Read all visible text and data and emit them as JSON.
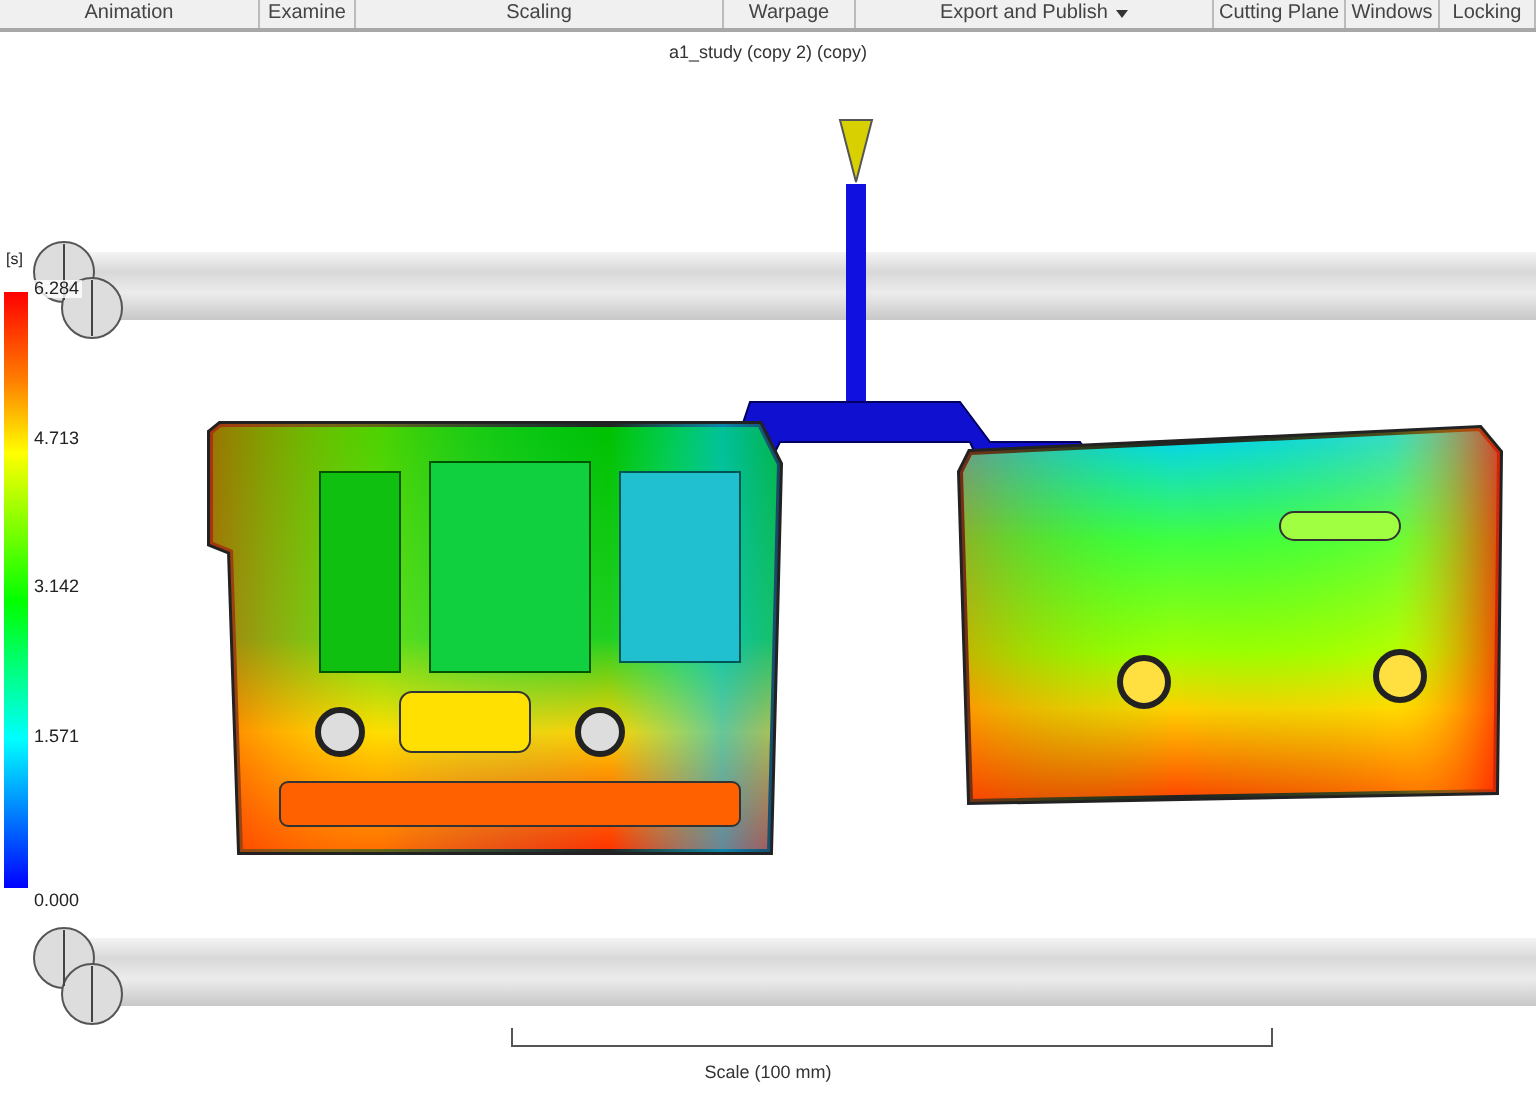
{
  "toolbar": {
    "groups": [
      {
        "label": "Animation",
        "has_menu": false
      },
      {
        "label": "Examine",
        "has_menu": false
      },
      {
        "label": "Scaling",
        "has_menu": false
      },
      {
        "label": "Warpage",
        "has_menu": false
      },
      {
        "label": "Export and Publish",
        "has_menu": true
      },
      {
        "label": "Cutting Plane",
        "has_menu": false
      },
      {
        "label": "Windows",
        "has_menu": false
      },
      {
        "label": "Locking",
        "has_menu": false
      }
    ]
  },
  "viewport": {
    "title": "a1_study (copy 2) (copy)",
    "legend": {
      "unit": "[s]",
      "ticks": [
        "6.284",
        "4.713",
        "3.142",
        "1.571",
        "0.000"
      ]
    },
    "scale": {
      "label": "Scale (100 mm)"
    }
  }
}
